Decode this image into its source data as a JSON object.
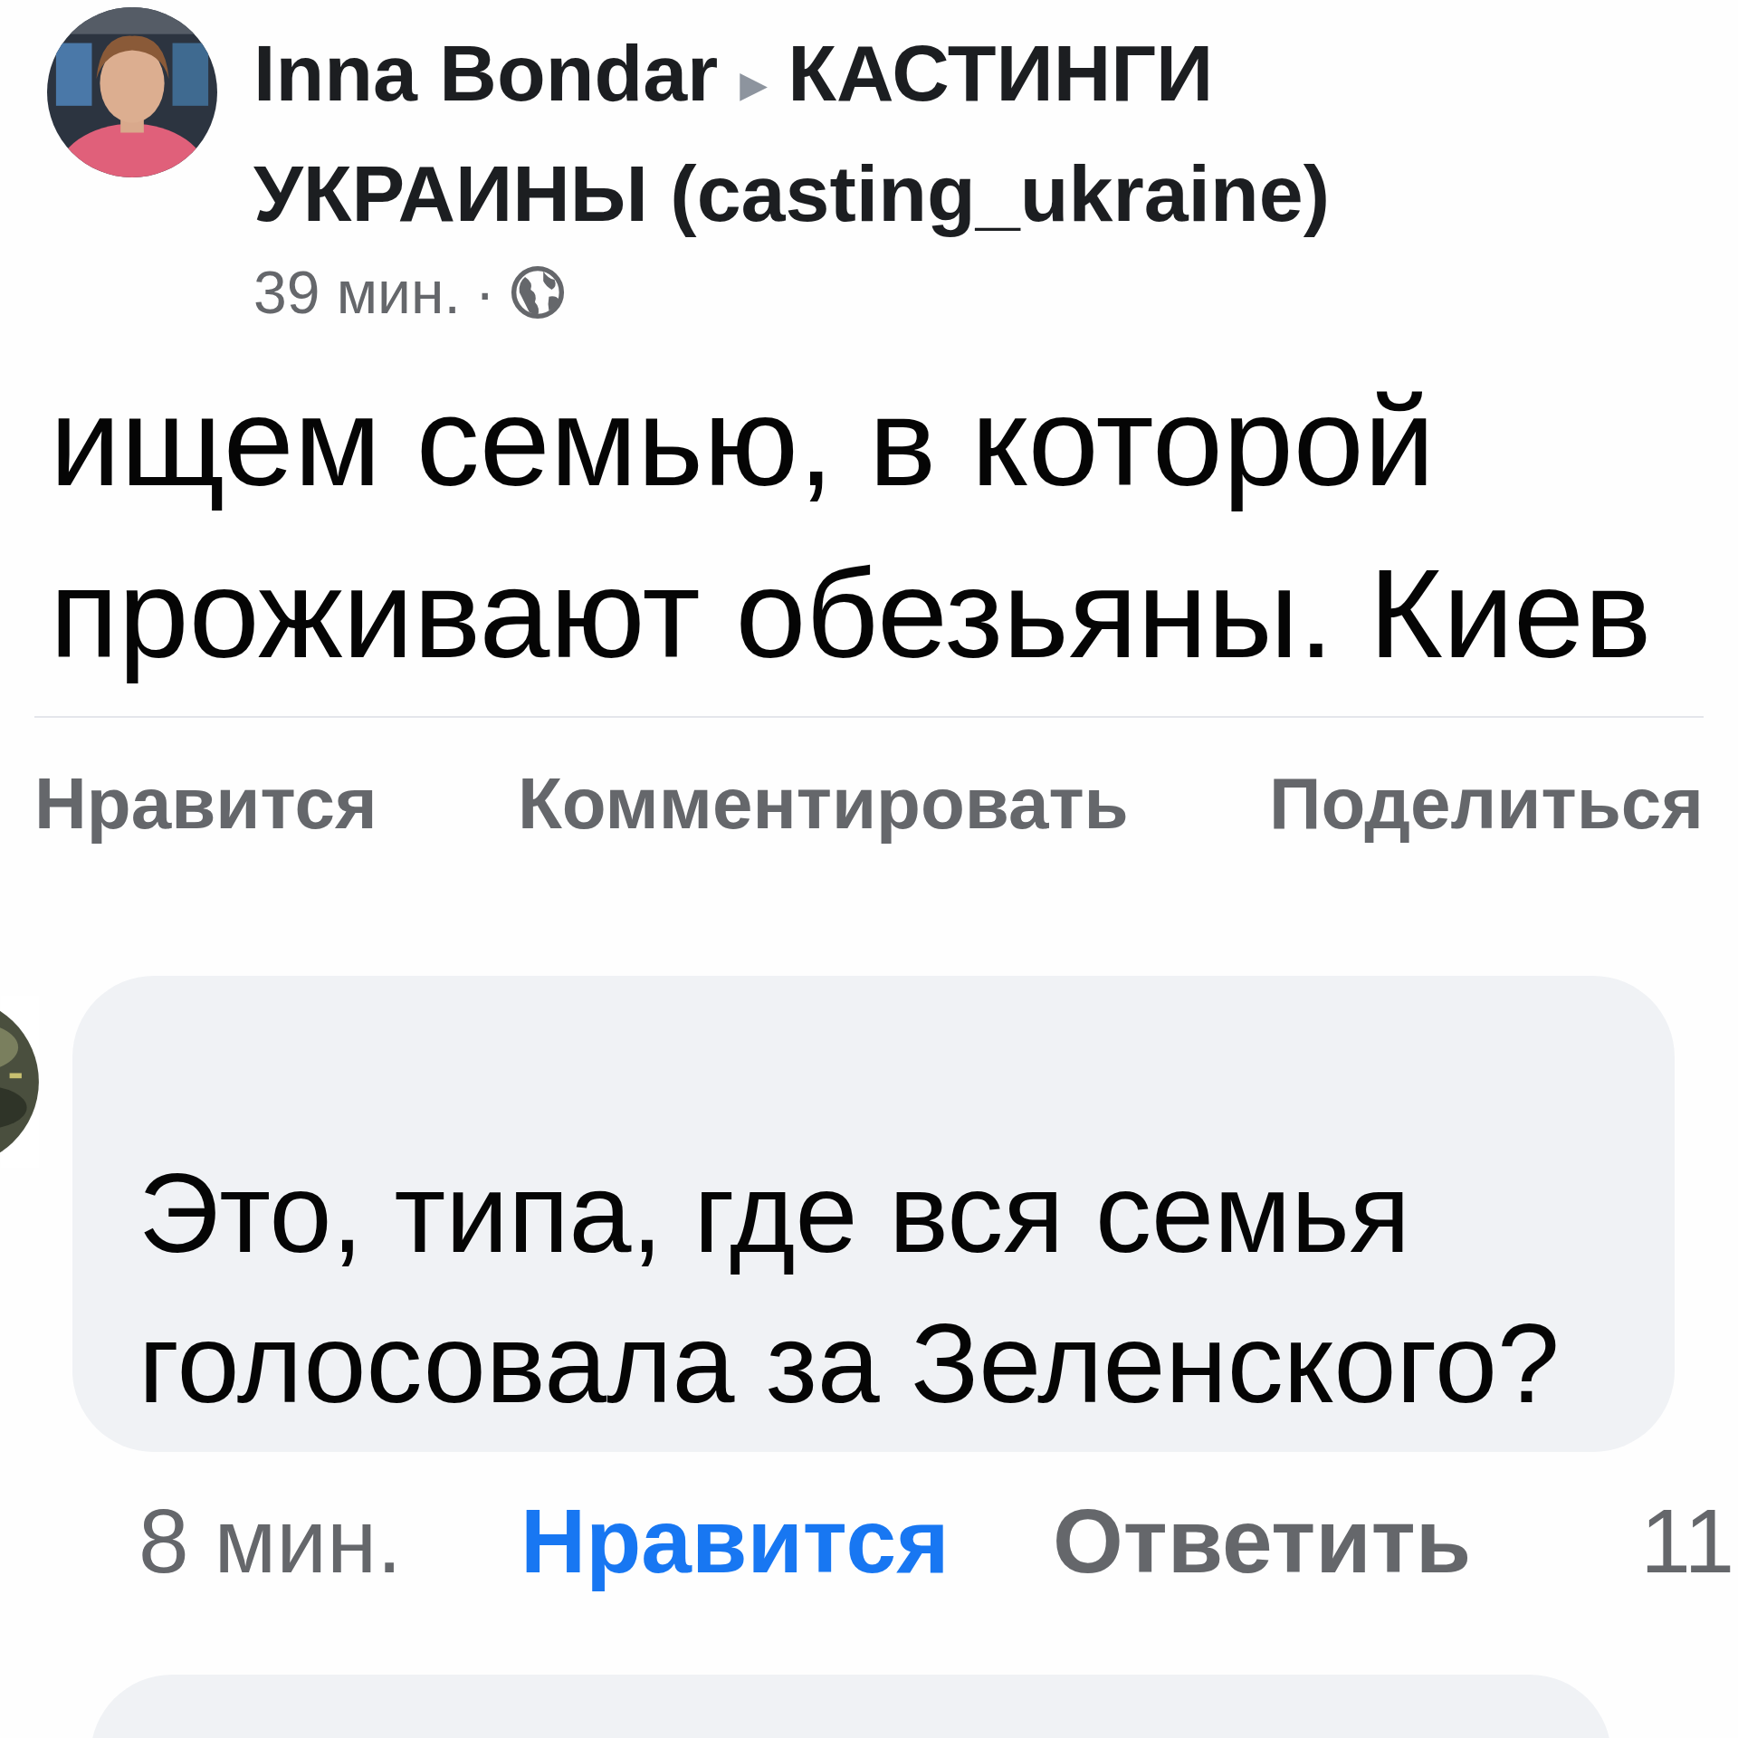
{
  "post": {
    "author": "Inna Bondar",
    "arrow": "▸",
    "group": "КАСТИНГИ УКРАИНЫ (casting_ukraine)",
    "time": "39 мин.",
    "separator": "·",
    "text": "ищем семью, в которой проживают обезьяны. Киев"
  },
  "actions": [
    {
      "label": "Нравится"
    },
    {
      "label": "Комментировать"
    },
    {
      "label": "Поделиться"
    }
  ],
  "comment": {
    "text": "Это, типа, где вся семья голосовала за Зеленского?",
    "time": "8 мин.",
    "like": {
      "label": "Нравится",
      "liked": true
    },
    "reply": "Ответить",
    "count": "11"
  }
}
